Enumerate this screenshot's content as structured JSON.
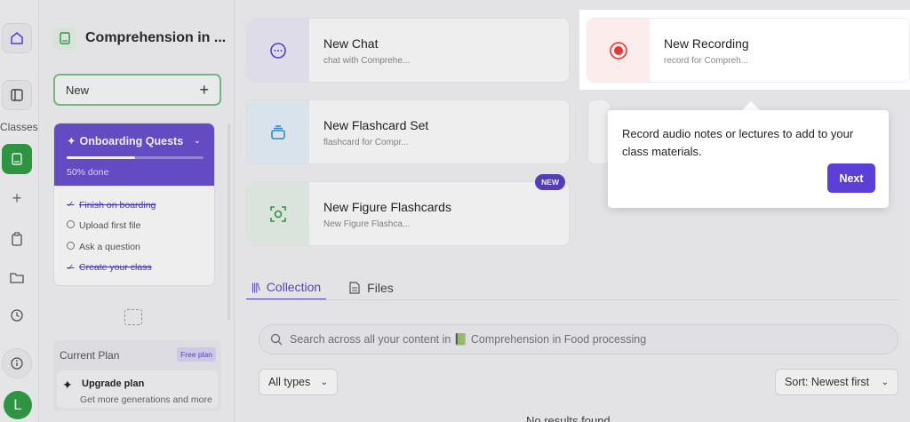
{
  "rail": {
    "classes_label": "Classes",
    "avatar_initial": "L"
  },
  "sidebar": {
    "class_title": "Comprehension in ...",
    "new_label": "New",
    "new_plus": "+",
    "quests": {
      "title": "Onboarding Quests",
      "progress_percent": 50,
      "progress_text": "50% done",
      "items": [
        {
          "label": "Finish on boarding",
          "done": true
        },
        {
          "label": "Upload first file",
          "done": false
        },
        {
          "label": "Ask a question",
          "done": false
        },
        {
          "label": "Create your class",
          "done": true
        }
      ]
    },
    "plan": {
      "label": "Current Plan",
      "badge": "Free plan",
      "upgrade_title": "Upgrade plan",
      "upgrade_sub": "Get more generations and more"
    }
  },
  "cards": {
    "chat": {
      "title": "New Chat",
      "sub": "chat with Comprehe..."
    },
    "flashcard": {
      "title": "New Flashcard Set",
      "sub": "flashcard for Compr..."
    },
    "figure": {
      "title": "New Figure Flashcards",
      "sub": "New Figure Flashca...",
      "badge": "NEW"
    },
    "recording": {
      "title": "New Recording",
      "sub": "record for Compreh..."
    }
  },
  "tabs": [
    {
      "label": "Collection",
      "active": true
    },
    {
      "label": "Files",
      "active": false
    }
  ],
  "search": {
    "placeholder": "Search across all your content in 📗 Comprehension in Food processing"
  },
  "filters": {
    "types": "All types",
    "sort": "Sort: Newest first"
  },
  "no_results": "No results found",
  "tooltip": {
    "text": "Record audio notes or lectures to add to your class materials.",
    "next_label": "Next"
  },
  "colors": {
    "accent": "#5b3fd6",
    "green": "#2f9e44",
    "record_red": "#e53935"
  }
}
